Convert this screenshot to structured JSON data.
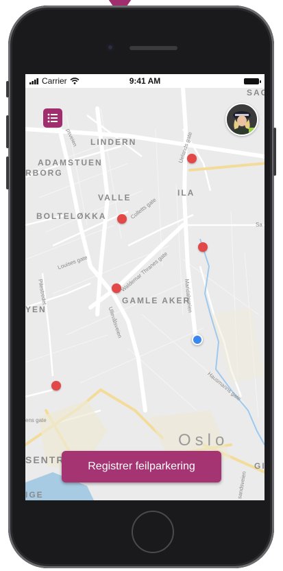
{
  "status_bar": {
    "carrier": "Carrier",
    "time": "9:41 AM"
  },
  "map": {
    "labels": {
      "lindern": "LINDERN",
      "adamstuen": "ADAMSTUEN",
      "borg": "RBORG",
      "valle": "VALLE",
      "ila": "ILA",
      "bolteloekka": "BOLTELØKKA",
      "gamle_aker": "GAMLE AKER",
      "yen": "YEN",
      "oslo": "Oslo",
      "sentr": "SENTR",
      "sag": "SAG",
      "gi": "GI",
      "ige": "IGE"
    },
    "streets": {
      "uelands_gate": "Uelands gate",
      "colletts_gate": "Colletts gate",
      "louises_gate": "Louises gate",
      "waldemar_thranes_gate": "Waldemar Thranes gate",
      "ullevalsveien": "Ullevålsveien",
      "maridalsveien": "Maridalsveien",
      "pilestredet": "Pilestredet",
      "hausmanns_gate": "Hausmanns gate",
      "psveien": "psveien",
      "ens_gate": "ens gate",
      "sa": "Sa",
      "sandsveien": "sandsveien"
    }
  },
  "actions": {
    "register_label": "Registrer feilparkering"
  },
  "colors": {
    "brand": "#a43572",
    "marker": "#e34848",
    "user_location": "#3a87f2"
  },
  "icons": {
    "menu": "list-menu-icon",
    "profile": "avatar"
  }
}
